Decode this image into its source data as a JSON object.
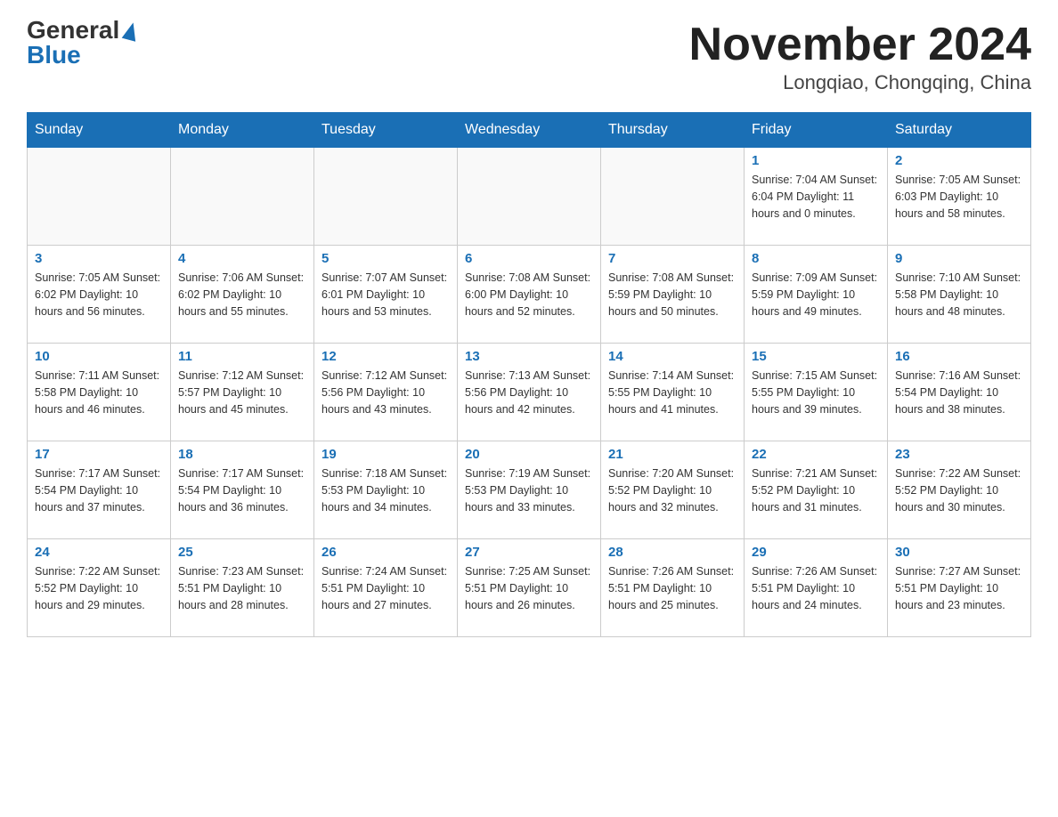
{
  "header": {
    "logo_general": "General",
    "logo_blue": "Blue",
    "month_title": "November 2024",
    "location": "Longqiao, Chongqing, China"
  },
  "days_of_week": [
    "Sunday",
    "Monday",
    "Tuesday",
    "Wednesday",
    "Thursday",
    "Friday",
    "Saturday"
  ],
  "weeks": [
    [
      {
        "day": "",
        "info": ""
      },
      {
        "day": "",
        "info": ""
      },
      {
        "day": "",
        "info": ""
      },
      {
        "day": "",
        "info": ""
      },
      {
        "day": "",
        "info": ""
      },
      {
        "day": "1",
        "info": "Sunrise: 7:04 AM\nSunset: 6:04 PM\nDaylight: 11 hours\nand 0 minutes."
      },
      {
        "day": "2",
        "info": "Sunrise: 7:05 AM\nSunset: 6:03 PM\nDaylight: 10 hours\nand 58 minutes."
      }
    ],
    [
      {
        "day": "3",
        "info": "Sunrise: 7:05 AM\nSunset: 6:02 PM\nDaylight: 10 hours\nand 56 minutes."
      },
      {
        "day": "4",
        "info": "Sunrise: 7:06 AM\nSunset: 6:02 PM\nDaylight: 10 hours\nand 55 minutes."
      },
      {
        "day": "5",
        "info": "Sunrise: 7:07 AM\nSunset: 6:01 PM\nDaylight: 10 hours\nand 53 minutes."
      },
      {
        "day": "6",
        "info": "Sunrise: 7:08 AM\nSunset: 6:00 PM\nDaylight: 10 hours\nand 52 minutes."
      },
      {
        "day": "7",
        "info": "Sunrise: 7:08 AM\nSunset: 5:59 PM\nDaylight: 10 hours\nand 50 minutes."
      },
      {
        "day": "8",
        "info": "Sunrise: 7:09 AM\nSunset: 5:59 PM\nDaylight: 10 hours\nand 49 minutes."
      },
      {
        "day": "9",
        "info": "Sunrise: 7:10 AM\nSunset: 5:58 PM\nDaylight: 10 hours\nand 48 minutes."
      }
    ],
    [
      {
        "day": "10",
        "info": "Sunrise: 7:11 AM\nSunset: 5:58 PM\nDaylight: 10 hours\nand 46 minutes."
      },
      {
        "day": "11",
        "info": "Sunrise: 7:12 AM\nSunset: 5:57 PM\nDaylight: 10 hours\nand 45 minutes."
      },
      {
        "day": "12",
        "info": "Sunrise: 7:12 AM\nSunset: 5:56 PM\nDaylight: 10 hours\nand 43 minutes."
      },
      {
        "day": "13",
        "info": "Sunrise: 7:13 AM\nSunset: 5:56 PM\nDaylight: 10 hours\nand 42 minutes."
      },
      {
        "day": "14",
        "info": "Sunrise: 7:14 AM\nSunset: 5:55 PM\nDaylight: 10 hours\nand 41 minutes."
      },
      {
        "day": "15",
        "info": "Sunrise: 7:15 AM\nSunset: 5:55 PM\nDaylight: 10 hours\nand 39 minutes."
      },
      {
        "day": "16",
        "info": "Sunrise: 7:16 AM\nSunset: 5:54 PM\nDaylight: 10 hours\nand 38 minutes."
      }
    ],
    [
      {
        "day": "17",
        "info": "Sunrise: 7:17 AM\nSunset: 5:54 PM\nDaylight: 10 hours\nand 37 minutes."
      },
      {
        "day": "18",
        "info": "Sunrise: 7:17 AM\nSunset: 5:54 PM\nDaylight: 10 hours\nand 36 minutes."
      },
      {
        "day": "19",
        "info": "Sunrise: 7:18 AM\nSunset: 5:53 PM\nDaylight: 10 hours\nand 34 minutes."
      },
      {
        "day": "20",
        "info": "Sunrise: 7:19 AM\nSunset: 5:53 PM\nDaylight: 10 hours\nand 33 minutes."
      },
      {
        "day": "21",
        "info": "Sunrise: 7:20 AM\nSunset: 5:52 PM\nDaylight: 10 hours\nand 32 minutes."
      },
      {
        "day": "22",
        "info": "Sunrise: 7:21 AM\nSunset: 5:52 PM\nDaylight: 10 hours\nand 31 minutes."
      },
      {
        "day": "23",
        "info": "Sunrise: 7:22 AM\nSunset: 5:52 PM\nDaylight: 10 hours\nand 30 minutes."
      }
    ],
    [
      {
        "day": "24",
        "info": "Sunrise: 7:22 AM\nSunset: 5:52 PM\nDaylight: 10 hours\nand 29 minutes."
      },
      {
        "day": "25",
        "info": "Sunrise: 7:23 AM\nSunset: 5:51 PM\nDaylight: 10 hours\nand 28 minutes."
      },
      {
        "day": "26",
        "info": "Sunrise: 7:24 AM\nSunset: 5:51 PM\nDaylight: 10 hours\nand 27 minutes."
      },
      {
        "day": "27",
        "info": "Sunrise: 7:25 AM\nSunset: 5:51 PM\nDaylight: 10 hours\nand 26 minutes."
      },
      {
        "day": "28",
        "info": "Sunrise: 7:26 AM\nSunset: 5:51 PM\nDaylight: 10 hours\nand 25 minutes."
      },
      {
        "day": "29",
        "info": "Sunrise: 7:26 AM\nSunset: 5:51 PM\nDaylight: 10 hours\nand 24 minutes."
      },
      {
        "day": "30",
        "info": "Sunrise: 7:27 AM\nSunset: 5:51 PM\nDaylight: 10 hours\nand 23 minutes."
      }
    ]
  ]
}
